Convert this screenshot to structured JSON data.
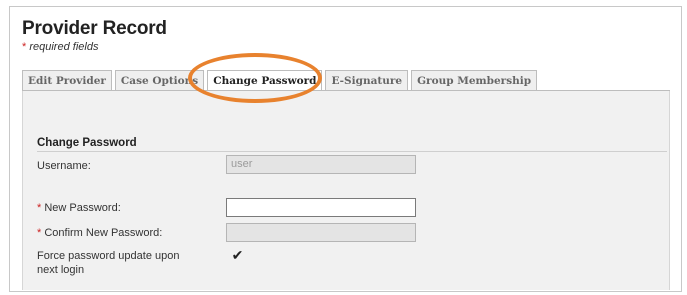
{
  "header": {
    "title": "Provider Record",
    "required_star": "*",
    "required_note": "required fields"
  },
  "tabs": [
    {
      "label": "Edit Provider",
      "active": false
    },
    {
      "label": "Case Options",
      "active": false
    },
    {
      "label": "Change Password",
      "active": true
    },
    {
      "label": "E-Signature",
      "active": false
    },
    {
      "label": "Group Membership",
      "active": false
    }
  ],
  "section": {
    "title": "Change Password"
  },
  "form": {
    "username_label": "Username:",
    "username_value": "user",
    "required_star": "*",
    "new_password_label": "New Password:",
    "new_password_value": "",
    "confirm_password_label": "Confirm New Password:",
    "confirm_password_value": "",
    "force_update_label_line1": "Force password update upon",
    "force_update_label_line2": "next login",
    "force_update_checked": true,
    "checkmark_glyph": "✔"
  },
  "annotation": {
    "highlight_color": "#e8822e"
  }
}
